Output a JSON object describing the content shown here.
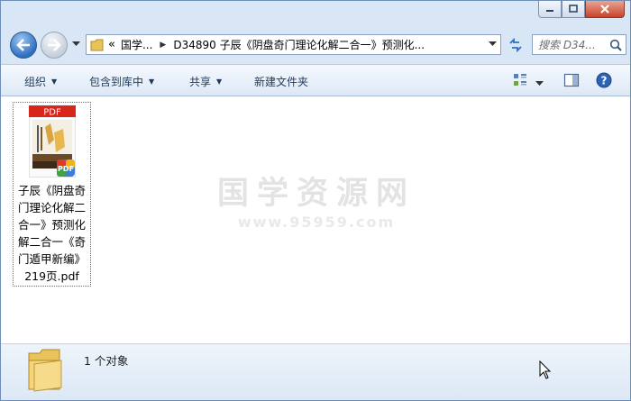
{
  "address_bar": {
    "crumbs": [
      "国学...",
      "D34890 子辰《阴盘奇门理论化解二合一》预测化..."
    ],
    "overflow_glyph": "«"
  },
  "search": {
    "placeholder": "搜索 D34..."
  },
  "toolbar": {
    "organize": "组织",
    "include_in_library": "包含到库中",
    "share": "共享",
    "new_folder": "新建文件夹"
  },
  "file": {
    "name": "子辰《阴盘奇门理论化解二合一》预测化解二合一《奇门遁甲新编》219页.pdf",
    "thumb_label": "PDF"
  },
  "watermark": {
    "title": "国学资源网",
    "url": "www.95959.com"
  },
  "details": {
    "item_count": "1 个对象"
  },
  "colors": {
    "pdf_red": "#d9261c",
    "window_frame": "#d9e6f5",
    "toolbar_text": "#1e395b"
  }
}
